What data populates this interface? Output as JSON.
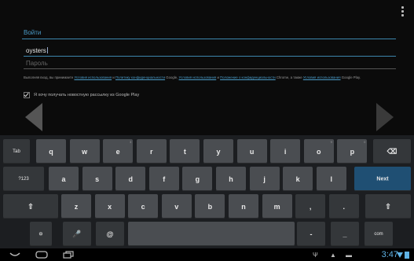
{
  "form": {
    "section_title": "Войти",
    "username_value": "oysters",
    "password_placeholder": "Пароль",
    "terms_prefix": "Выполняя вход, вы принимаете",
    "terms_link1": "Условия использования",
    "terms_and": "и",
    "terms_link2": "Политику конфиденциальности",
    "terms_mid": "Google,",
    "terms_link3": "Условия использования",
    "terms_link4": "Положение о конфиденциальности",
    "terms_tail": "Chrome, а также",
    "terms_link5": "Условия использования",
    "terms_end": "Google Play.",
    "newsletter_label": "Я хочу получать новостную рассылку из Google Play"
  },
  "keyboard": {
    "row1": [
      "Tab",
      "q",
      "w",
      "e",
      "r",
      "t",
      "y",
      "u",
      "i",
      "o",
      "p",
      "⌫"
    ],
    "row2": [
      "?123",
      "a",
      "s",
      "d",
      "f",
      "g",
      "h",
      "j",
      "k",
      "l",
      "Next"
    ],
    "row3": [
      "⇧",
      "z",
      "x",
      "c",
      "v",
      "b",
      "n",
      "m",
      ",",
      ".",
      "⇧"
    ],
    "row4": [
      "⚙",
      "🎤",
      "@",
      "",
      "-",
      "_",
      "com"
    ],
    "subs": {
      "e": "3",
      "o": "9",
      "p": "0"
    }
  },
  "statusbar": {
    "time": "3:47",
    "icons": [
      "back-icon",
      "home-icon",
      "recent-apps-icon",
      "usb-icon",
      "warning-icon",
      "download-icon",
      "wifi-icon",
      "battery-icon"
    ]
  }
}
